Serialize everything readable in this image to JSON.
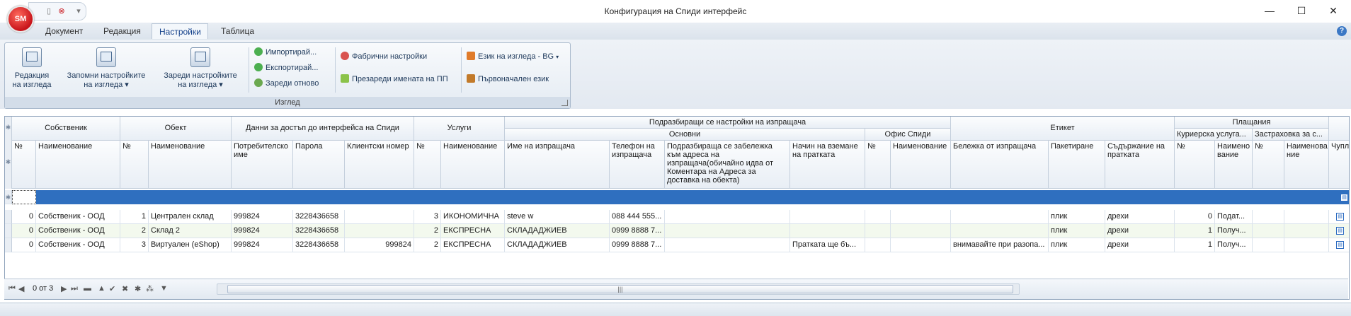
{
  "window": {
    "title": "Конфигурация на Спиди интерфейс",
    "logo_text": "SM",
    "controls": {
      "minimize": "—",
      "maximize": "☐",
      "close": "✕"
    },
    "help": "?"
  },
  "ribbon": {
    "tabs": [
      {
        "label": "Документ",
        "active": false
      },
      {
        "label": "Редакция",
        "active": false
      },
      {
        "label": "Настройки",
        "active": true
      },
      {
        "label": "Таблица",
        "active": false
      }
    ],
    "group_caption": "Изглед",
    "big_buttons": [
      {
        "line1": "Редакция",
        "line2": "на изгледа",
        "icon": "layout-edit-icon"
      },
      {
        "line1": "Запомни настройките",
        "line2": "на изгледа ▾",
        "icon": "save-layout-icon"
      },
      {
        "line1": "Зареди настройките",
        "line2": "на изгледа ▾",
        "icon": "load-layout-icon"
      }
    ],
    "small_buttons": {
      "import": "Импортирай...",
      "export": "Експортирай...",
      "reload": "Зареди отново",
      "factory": "Фабрични настройки",
      "rename": "Презареди имената на ПП",
      "language": "Език на изгледа - BG",
      "original_language": "Първоначален език"
    },
    "accent_color": "#15428b"
  },
  "grid": {
    "band_headers": {
      "owner": "Собственик",
      "object": "Обект",
      "access": "Данни за достъп до интерфейса на Спиди",
      "services": "Услуги",
      "sender_settings": "Подразбиращи се настройки на изпращача",
      "basic": "Основни",
      "speedy_office": "Офис Спиди",
      "label": "Етикет",
      "payments": "Плащания",
      "courier_service": "Куриерска услуга...",
      "insurance": "Застраховка за с..."
    },
    "columns": {
      "owner_no": "№",
      "owner_name": "Наименование",
      "object_no": "№",
      "object_name": "Наименование",
      "username": "Потребителско име",
      "password": "Парола",
      "client_no": "Клиентски номер",
      "service_no": "№",
      "service_name": "Наименование",
      "sender_name": "Име на изпращача",
      "sender_phone": "Телефон на изпращача",
      "default_note": "Подразбираща се забележка към адреса на изпращача(обичайно идва от Коментара на Адреса за доставка на обекта)",
      "pickup_method": "Начин на вземане на пратката",
      "office_no": "№",
      "office_name": "Наименование",
      "sender_note": "Бележка от изпращача",
      "packaging": "Пакетиране",
      "contents": "Съдържание на пратката",
      "pay_courier_no": "№",
      "pay_courier_name": "Наимено вание",
      "pay_ins_no": "№",
      "pay_ins_name": "Наименова ние",
      "fragile": "Чупли"
    },
    "rows": [
      {
        "owner_no": "0",
        "owner_name": "Собственик - ООД",
        "object_no": "1",
        "object_name": "Централен склад",
        "username": "999824",
        "password": "3228436658",
        "client_no": "",
        "service_no": "3",
        "service_name": "ИКОНОМИЧНА",
        "sender_name": "steve w",
        "sender_phone": "088 444 555...",
        "default_note": "",
        "pickup_method": "",
        "office_no": "",
        "office_name": "",
        "sender_note": "",
        "packaging": "плик",
        "contents": "дрехи",
        "pay_courier_no": "0",
        "pay_courier_name": "Подат...",
        "pay_ins_no": "",
        "pay_ins_name": ""
      },
      {
        "owner_no": "0",
        "owner_name": "Собственик - ООД",
        "object_no": "2",
        "object_name": "Склад 2",
        "username": "999824",
        "password": "3228436658",
        "client_no": "",
        "service_no": "2",
        "service_name": "ЕКСПРЕСНА",
        "sender_name": "СКЛАДАДЖИЕВ",
        "sender_phone": "0999 8888 7...",
        "default_note": "",
        "pickup_method": "",
        "office_no": "",
        "office_name": "",
        "sender_note": "",
        "packaging": "плик",
        "contents": "дрехи",
        "pay_courier_no": "1",
        "pay_courier_name": "Получ...",
        "pay_ins_no": "",
        "pay_ins_name": ""
      },
      {
        "owner_no": "0",
        "owner_name": "Собственик - ООД",
        "object_no": "3",
        "object_name": "Виртуален (eShop)",
        "username": "999824",
        "password": "3228436658",
        "client_no": "999824",
        "service_no": "2",
        "service_name": "ЕКСПРЕСНА",
        "sender_name": "СКЛАДАДЖИЕВ",
        "sender_phone": "0999 8888 7...",
        "default_note": "",
        "pickup_method": "Пратката ще бъ...",
        "office_no": "",
        "office_name": "",
        "sender_note": "внимавайте при разопа...",
        "packaging": "плик",
        "contents": "дрехи",
        "pay_courier_no": "1",
        "pay_courier_name": "Получ...",
        "pay_ins_no": "",
        "pay_ins_name": ""
      }
    ],
    "new_row_color": "#2f6fbf"
  },
  "navigator": {
    "record_text": "0 от 3",
    "buttons": [
      "⏮",
      "◀",
      "▶",
      "⏭",
      "▬",
      "▲",
      "✔",
      "✖",
      "✱",
      "⁂",
      "▼"
    ],
    "scroll_grip": "|||"
  }
}
